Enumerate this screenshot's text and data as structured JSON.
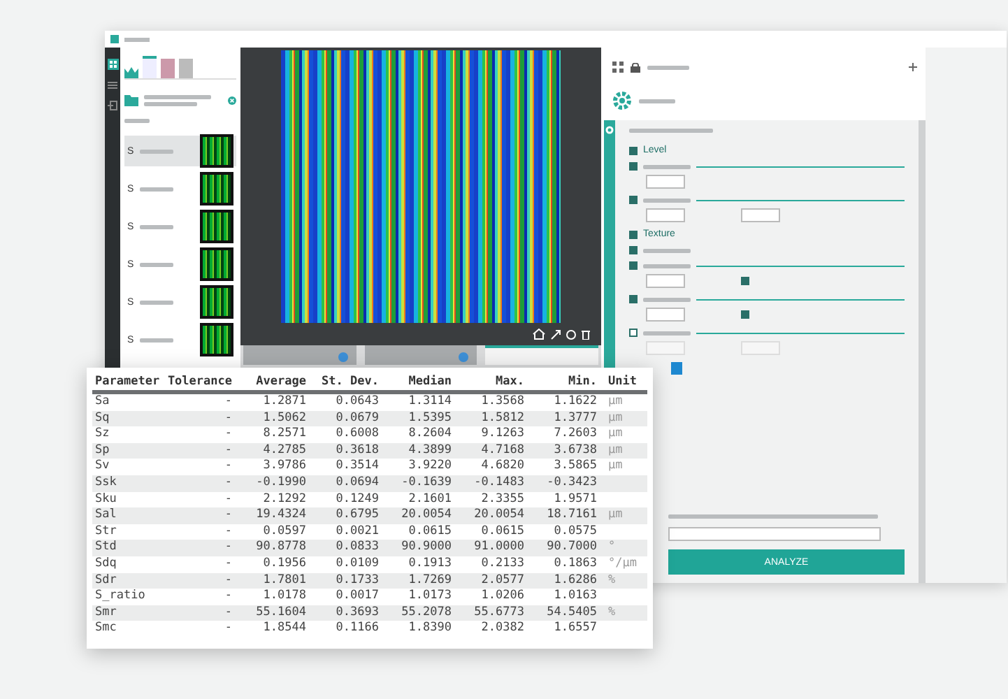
{
  "sidebar": {
    "files": [
      {
        "prefix": "S",
        "selected": true
      },
      {
        "prefix": "S",
        "selected": false
      },
      {
        "prefix": "S",
        "selected": false
      },
      {
        "prefix": "S",
        "selected": false
      },
      {
        "prefix": "S",
        "selected": false
      },
      {
        "prefix": "S",
        "selected": false
      }
    ]
  },
  "viewer": {
    "tabs": [
      {
        "selected": false
      },
      {
        "selected": false
      },
      {
        "selected": true
      }
    ]
  },
  "panel": {
    "options": [
      {
        "kind": "plain",
        "label": "Level",
        "checked": true
      },
      {
        "kind": "one-field",
        "checked": true
      },
      {
        "kind": "two-fields",
        "checked": true
      },
      {
        "kind": "plain",
        "label": "Texture",
        "checked": true
      },
      {
        "kind": "plain",
        "checked": true
      },
      {
        "kind": "field-and-check",
        "checked": true,
        "edge_checked": true
      },
      {
        "kind": "field-and-check",
        "checked": true,
        "edge_checked": true
      },
      {
        "kind": "two-fields",
        "checked": false
      }
    ],
    "action": "ANALYZE"
  },
  "table": {
    "columns": [
      "Parameter",
      "Tolerance",
      "Average",
      "St. Dev.",
      "Median",
      "Max.",
      "Min.",
      "Unit"
    ],
    "rows": [
      [
        "Sa",
        "-",
        "1.2871",
        "0.0643",
        "1.3114",
        "1.3568",
        "1.1622",
        "µm"
      ],
      [
        "Sq",
        "-",
        "1.5062",
        "0.0679",
        "1.5395",
        "1.5812",
        "1.3777",
        "µm"
      ],
      [
        "Sz",
        "-",
        "8.2571",
        "0.6008",
        "8.2604",
        "9.1263",
        "7.2603",
        "µm"
      ],
      [
        "Sp",
        "-",
        "4.2785",
        "0.3618",
        "4.3899",
        "4.7168",
        "3.6738",
        "µm"
      ],
      [
        "Sv",
        "-",
        "3.9786",
        "0.3514",
        "3.9220",
        "4.6820",
        "3.5865",
        "µm"
      ],
      [
        "Ssk",
        "-",
        "-0.1990",
        "0.0694",
        "-0.1639",
        "-0.1483",
        "-0.3423"
      ],
      [
        "Sku",
        "-",
        "2.1292",
        "0.1249",
        "2.1601",
        "2.3355",
        "1.9571"
      ],
      [
        "Sal",
        "-",
        "19.4324",
        "0.6795",
        "20.0054",
        "20.0054",
        "18.7161",
        "µm"
      ],
      [
        "Str",
        "-",
        "0.0597",
        "0.0021",
        "0.0615",
        "0.0615",
        "0.0575"
      ],
      [
        "Std",
        "-",
        "90.8778",
        "0.0833",
        "90.9000",
        "91.0000",
        "90.7000",
        "°"
      ],
      [
        "Sdq",
        "-",
        "0.1956",
        "0.0109",
        "0.1913",
        "0.2133",
        "0.1863",
        "°/µm"
      ],
      [
        "Sdr",
        "-",
        "1.7801",
        "0.1733",
        "1.7269",
        "2.0577",
        "1.6286",
        "%"
      ],
      [
        "S_ratio",
        "-",
        "1.0178",
        "0.0017",
        "1.0173",
        "1.0206",
        "1.0163"
      ],
      [
        "Smr",
        "-",
        "55.1604",
        "0.3693",
        "55.2078",
        "55.6773",
        "54.5405",
        "%"
      ],
      [
        "Smc",
        "-",
        "1.8544",
        "0.1166",
        "1.8390",
        "2.0382",
        "1.6557"
      ]
    ]
  }
}
